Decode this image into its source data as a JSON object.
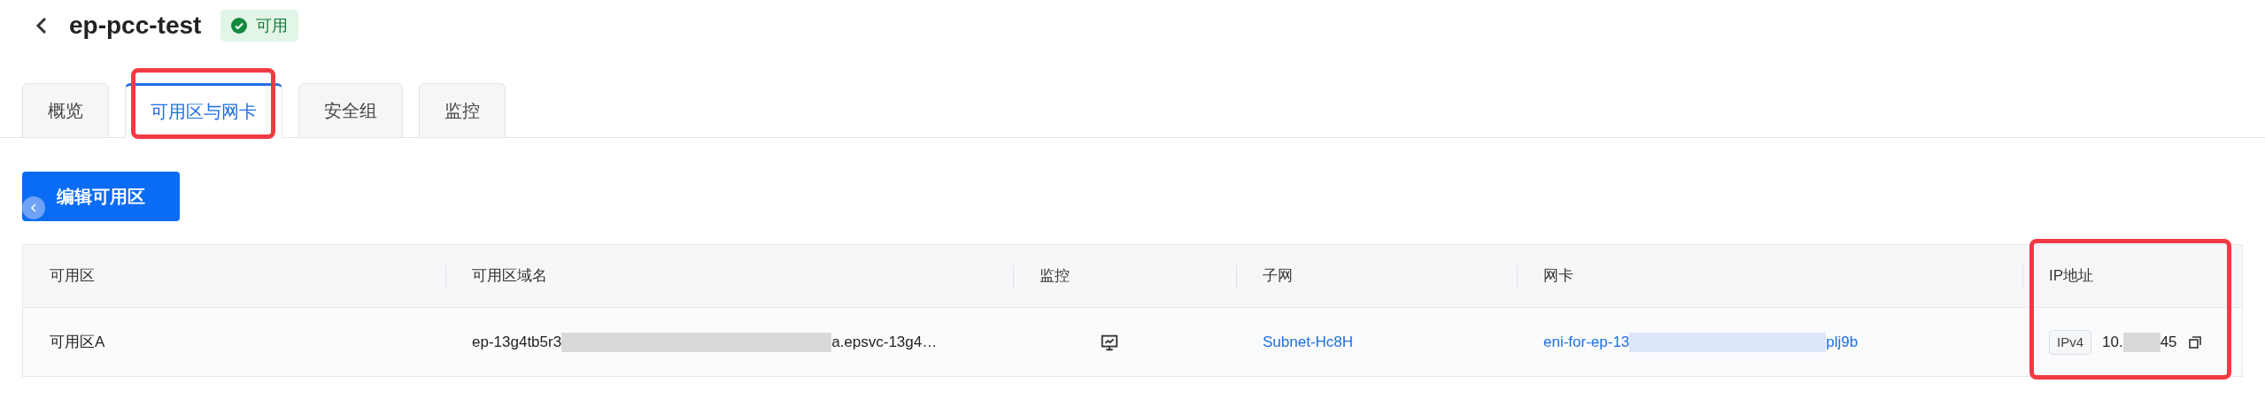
{
  "header": {
    "title": "ep-pcc-test",
    "status": {
      "label": "可用",
      "kind": "ok"
    }
  },
  "tabs": [
    {
      "label": "概览",
      "selected": false,
      "highlighted": false
    },
    {
      "label": "可用区与网卡",
      "selected": true,
      "highlighted": true
    },
    {
      "label": "安全组",
      "selected": false,
      "highlighted": false
    },
    {
      "label": "监控",
      "selected": false,
      "highlighted": false
    }
  ],
  "edit_button": "编辑可用区",
  "table": {
    "columns": [
      {
        "label": "可用区",
        "highlighted": false
      },
      {
        "label": "可用区域名",
        "highlighted": false
      },
      {
        "label": "监控",
        "highlighted": false
      },
      {
        "label": "子网",
        "highlighted": false
      },
      {
        "label": "网卡",
        "highlighted": false
      },
      {
        "label": "IP地址",
        "highlighted": true
      }
    ],
    "rows": [
      {
        "zone": "可用区A",
        "domain": {
          "before": "ep-13g4tb5r3",
          "after": "a.epsvc-13g4…"
        },
        "subnet": "Subnet-Hc8H",
        "eni": {
          "before": "eni-for-ep-13",
          "after": "plj9b"
        },
        "ip": {
          "version": "IPv4",
          "before": "10.",
          "after": "45"
        }
      }
    ]
  }
}
